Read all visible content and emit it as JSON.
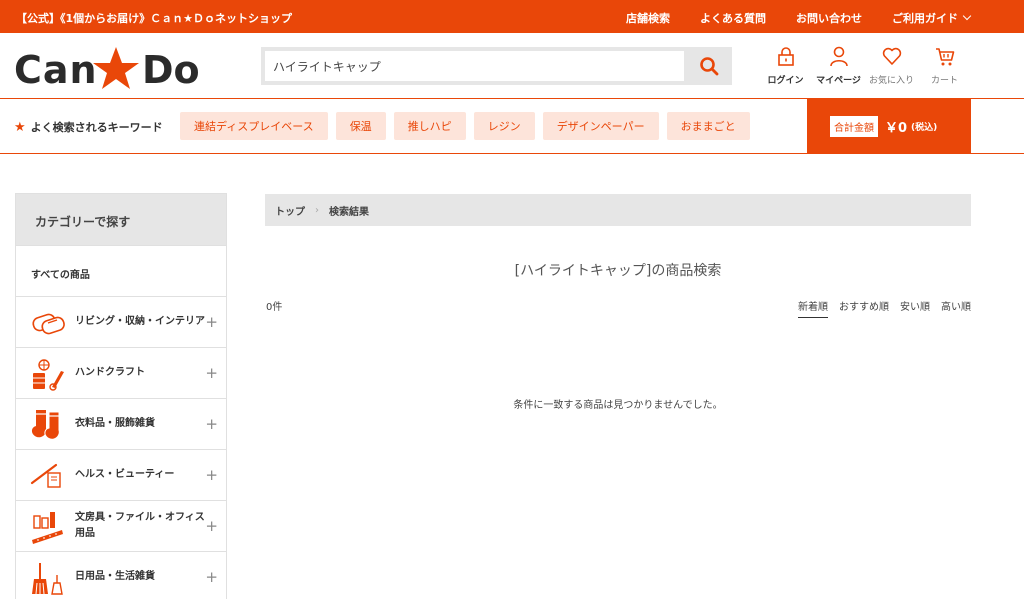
{
  "topbar": {
    "tagline": "【公式】《1個からお届け》Ｃａｎ★Ｄｏネットショップ",
    "links": [
      "店舗検索",
      "よくある質問",
      "お問い合わせ",
      "ご利用ガイド"
    ]
  },
  "header": {
    "logo_text": "Can★Do",
    "search_value": "ハイライトキャップ",
    "icons": [
      {
        "icon": "lock-icon",
        "label": "ログイン"
      },
      {
        "icon": "person-icon",
        "label": "マイページ"
      },
      {
        "icon": "heart-icon",
        "label": "お気に入り"
      },
      {
        "icon": "cart-icon",
        "label": "カート"
      }
    ]
  },
  "keywords": {
    "title": "よく検索されるキーワード",
    "items": [
      "連結ディスプレイベース",
      "保温",
      "推しハピ",
      "レジン",
      "デザインペーパー",
      "おままごと"
    ]
  },
  "total": {
    "label": "合計金額",
    "amount": "￥0",
    "tax": "(税込)"
  },
  "sidebar": {
    "title": "カテゴリーで探す",
    "all_label": "すべての商品",
    "categories": [
      {
        "label": "リビング・収納・インテリア",
        "icon": "interior-icon"
      },
      {
        "label": "ハンドクラフト",
        "icon": "handcraft-icon"
      },
      {
        "label": "衣料品・服飾雑貨",
        "icon": "socks-icon"
      },
      {
        "label": "ヘルス・ビューティー",
        "icon": "beauty-icon"
      },
      {
        "label": "文房具・ファイル・オフィス用品",
        "icon": "stationery-icon"
      },
      {
        "label": "日用品・生活雑貨",
        "icon": "broom-icon"
      }
    ]
  },
  "breadcrumb": [
    "トップ",
    "検索結果"
  ],
  "main": {
    "title": "[ハイライトキャップ]の商品検索",
    "count": "0件",
    "sorts": [
      "新着順",
      "おすすめ順",
      "安い順",
      "高い順"
    ],
    "empty_message": "条件に一致する商品は見つかりませんでした。"
  },
  "colors": {
    "accent": "#e94709",
    "chip_bg": "#fde4da",
    "panel_gray": "#e6e6e6"
  }
}
